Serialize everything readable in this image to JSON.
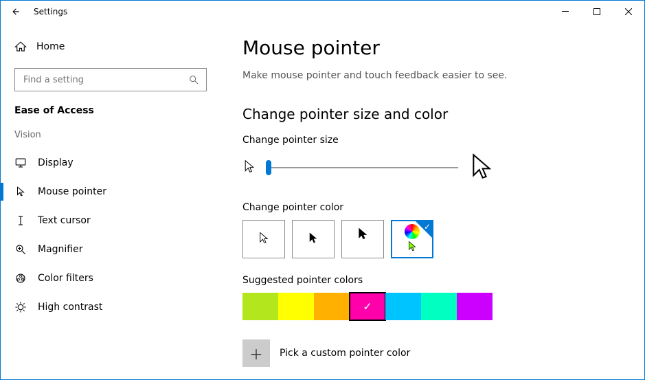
{
  "window": {
    "title": "Settings"
  },
  "sidebar": {
    "home": "Home",
    "search_placeholder": "Find a setting",
    "section": "Ease of Access",
    "group": "Vision",
    "items": [
      {
        "label": "Display"
      },
      {
        "label": "Mouse pointer"
      },
      {
        "label": "Text cursor"
      },
      {
        "label": "Magnifier"
      },
      {
        "label": "Color filters"
      },
      {
        "label": "High contrast"
      }
    ],
    "selected_index": 1
  },
  "main": {
    "title": "Mouse pointer",
    "subtitle": "Make mouse pointer and touch feedback easier to see.",
    "section1": "Change pointer size and color",
    "size_label": "Change pointer size",
    "color_label": "Change pointer color",
    "suggested_label": "Suggested pointer colors",
    "custom_label": "Pick a custom pointer color",
    "suggested_colors": [
      "#b4e61e",
      "#ffff00",
      "#ffb000",
      "#ff00aa",
      "#00c4ff",
      "#00ffc1",
      "#cc00ff"
    ],
    "suggested_selected_index": 3,
    "scheme_selected_index": 3
  }
}
